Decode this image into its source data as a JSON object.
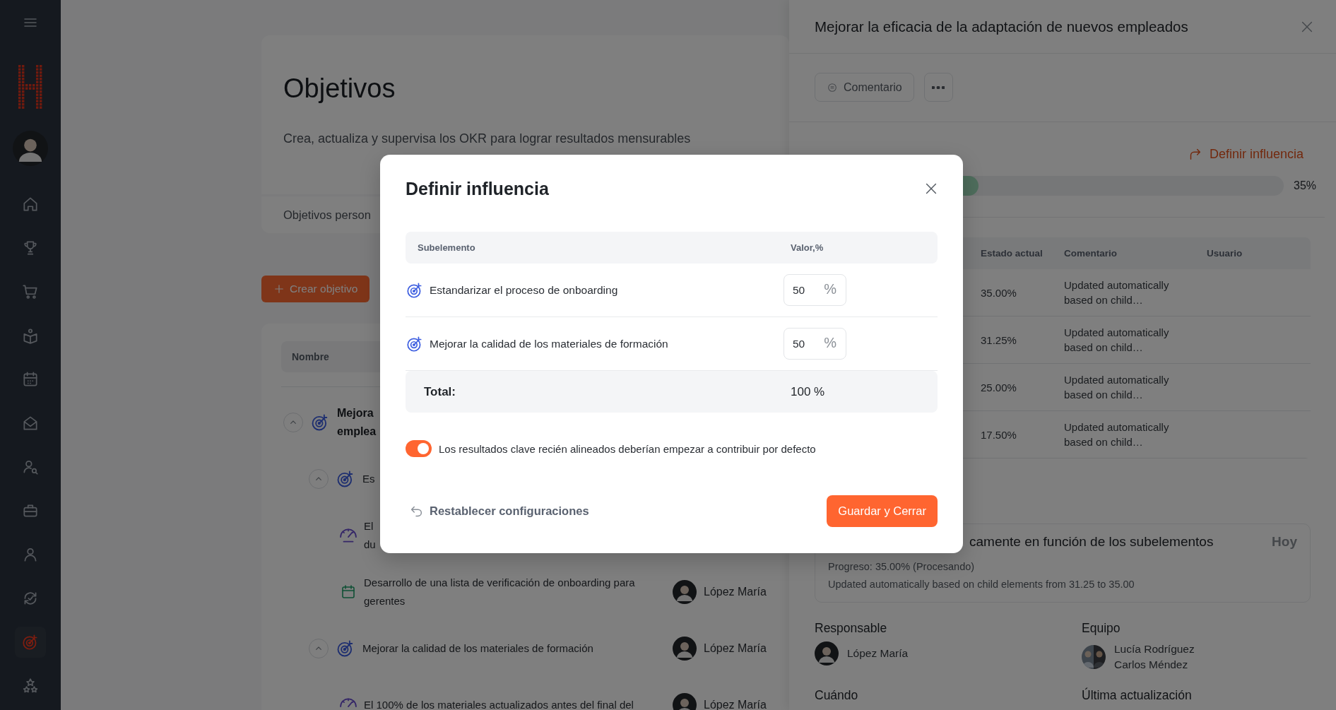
{
  "sidebar": {
    "items": [
      {
        "selected": false
      },
      {
        "selected": false
      },
      {
        "selected": false
      },
      {
        "selected": false
      },
      {
        "selected": false
      },
      {
        "selected": false
      },
      {
        "selected": false
      },
      {
        "selected": false
      },
      {
        "selected": false
      },
      {
        "selected": false
      },
      {
        "selected": true
      },
      {
        "selected": false
      }
    ]
  },
  "page": {
    "title": "Objetivos",
    "subtitle": "Crea, actualiza y supervisa los OKR para lograr resultados mensurables",
    "tabs": [
      {
        "label": "Objetivos person"
      }
    ],
    "create_button": "Crear objetivo",
    "table": {
      "columns": [
        "Nombre"
      ],
      "rows": [
        {
          "kind": "objective",
          "lines": [
            "Mejora",
            "emplea"
          ],
          "expanded": true,
          "children": [
            {
              "kind": "objective",
              "lines": [
                "Es"
              ],
              "expanded": true,
              "children": [
                {
                  "kind": "metric",
                  "lines": [
                    "El",
                    "du"
                  ]
                },
                {
                  "kind": "task",
                  "title": "Desarrollo de una lista de verificación de onboarding para gerentes",
                  "owner": "López María"
                }
              ]
            },
            {
              "kind": "objective",
              "title": "Mejorar la calidad de los materiales de formación",
              "owner": "López María",
              "expanded": true,
              "children": [
                {
                  "kind": "metric",
                  "title": "El 100% de los materiales actualizados antes del final del",
                  "owner": "López María"
                }
              ]
            }
          ]
        }
      ]
    }
  },
  "panel": {
    "title": "Mejorar la eficacia de la adaptación de nuevos empleados",
    "comment_button": "Comentario",
    "influence_link": "Definir influencia",
    "progress": {
      "level": 0.35,
      "reading": "35%"
    },
    "table": {
      "columns": [
        "Estado actual",
        "Comentario",
        "Usuario"
      ],
      "rows": [
        {
          "status": "35.00%",
          "comment": "Updated automatically based on child…"
        },
        {
          "status": "31.25%",
          "comment": "Updated automatically based on child…"
        },
        {
          "status": "25.00%",
          "comment": "Updated automatically based on child…"
        },
        {
          "status": "17.50%",
          "comment": "Updated automatically based on child…"
        }
      ]
    },
    "update": {
      "title": "camente en función de los subelementos",
      "date": "Hoy",
      "lines": [
        "Progreso: 35.00% (Procesando)",
        "Updated automatically based on child elements from 31.25 to 35.00"
      ]
    },
    "fields": [
      {
        "label": "Responsable",
        "people": [
          "López María"
        ]
      },
      {
        "label": "Equipo",
        "people": [
          "Lucía Rodríguez",
          "Carlos Méndez"
        ]
      },
      {
        "label": "Cuándo"
      },
      {
        "label": "Última actualización"
      }
    ]
  },
  "modal": {
    "title": "Definir influencia",
    "columns": [
      "Subelemento",
      "Valor,%"
    ],
    "rows": [
      {
        "name": "Estandarizar el proceso de onboarding",
        "value": "50",
        "unit": "%"
      },
      {
        "name": "Mejorar la calidad de los materiales de formación",
        "value": "50",
        "unit": "%"
      }
    ],
    "total_label": "Total:",
    "total_value": "100 %",
    "toggle": {
      "on": true,
      "label": "Los resultados clave recién alineados deberían empezar a contribuir por defecto"
    },
    "reset_button": "Restablecer configuraciones",
    "save_button": "Guardar y Cerrar"
  }
}
